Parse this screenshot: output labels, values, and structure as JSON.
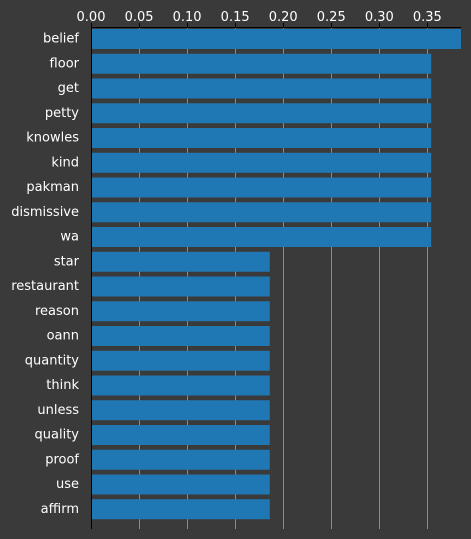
{
  "chart_data": {
    "type": "bar",
    "orientation": "horizontal",
    "title": "",
    "xlabel": "",
    "ylabel": "",
    "xlim": [
      0,
      0.385
    ],
    "x_ticks": [
      0.0,
      0.05,
      0.1,
      0.15,
      0.2,
      0.25,
      0.3,
      0.35
    ],
    "x_tick_labels": [
      "0.00",
      "0.05",
      "0.10",
      "0.15",
      "0.20",
      "0.25",
      "0.30",
      "0.35"
    ],
    "x_axis_position": "top",
    "grid": "vertical",
    "legend": "none",
    "categories": [
      "belief",
      "floor",
      "get",
      "petty",
      "knowles",
      "kind",
      "pakman",
      "dismissive",
      "wa",
      "star",
      "restaurant",
      "reason",
      "oann",
      "quantity",
      "think",
      "unless",
      "quality",
      "proof",
      "use",
      "affirm"
    ],
    "values": [
      0.385,
      0.354,
      0.354,
      0.354,
      0.354,
      0.354,
      0.354,
      0.354,
      0.354,
      0.186,
      0.186,
      0.186,
      0.186,
      0.186,
      0.186,
      0.186,
      0.186,
      0.186,
      0.186,
      0.186
    ],
    "colors": {
      "bar": "#1f77b4",
      "background": "#3b3a3a",
      "axis": "#000000",
      "grid": "#8a8a8a",
      "text": "#ffffff"
    }
  }
}
